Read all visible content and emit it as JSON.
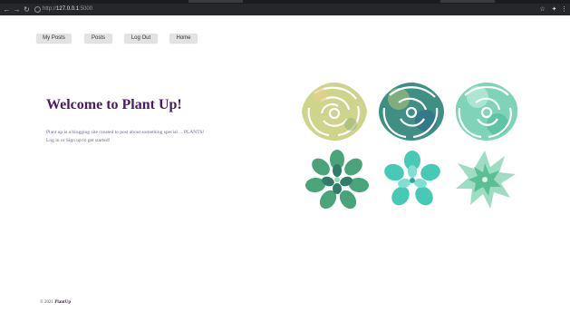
{
  "browser": {
    "url_scheme": "http://",
    "url_host": "127.0.0.1",
    "url_port": ":5000"
  },
  "nav": {
    "items": [
      {
        "label": "My Posts"
      },
      {
        "label": "Posts"
      },
      {
        "label": "Log Out"
      },
      {
        "label": "Home"
      }
    ]
  },
  "hero": {
    "title": "Welcome to Plant Up!",
    "line1": "Plant up is a blogging site created to post about something special… PLANTS!",
    "line2": "Log in or Sign up to get started!"
  },
  "gallery": {
    "colors": {
      "yellow": "#c9cf7e",
      "teal_dark": "#3f8f84",
      "mint": "#7fd3b8",
      "green": "#4aa47a",
      "cyan": "#46c9b5",
      "pale": "#9edcc4"
    }
  },
  "footer": {
    "copyright": "© 2021",
    "brand": "PlantUp"
  }
}
